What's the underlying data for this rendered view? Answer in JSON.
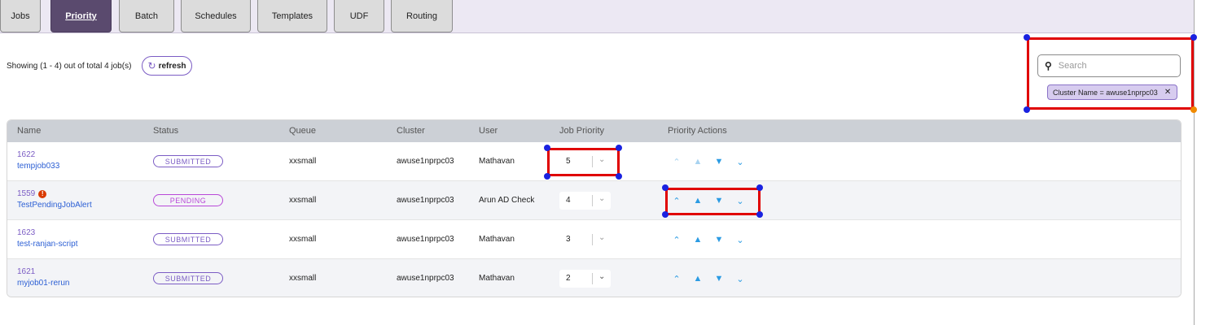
{
  "tabs": [
    {
      "label": "Jobs",
      "active": false
    },
    {
      "label": "Priority",
      "active": true
    },
    {
      "label": "Batch",
      "active": false
    },
    {
      "label": "Schedules",
      "active": false
    },
    {
      "label": "Templates",
      "active": false
    },
    {
      "label": "UDF",
      "active": false
    },
    {
      "label": "Routing",
      "active": false
    }
  ],
  "summary": {
    "showing_text": "Showing  (1 - 4)  out of total 4 job(s)",
    "refresh_label": "refresh"
  },
  "search": {
    "placeholder": "Search",
    "filter_chip": "Cluster Name = awuse1nprpc03"
  },
  "table": {
    "headers": {
      "name": "Name",
      "status": "Status",
      "queue": "Queue",
      "cluster": "Cluster",
      "user": "User",
      "job_priority": "Job Priority",
      "priority_actions": "Priority Actions"
    },
    "rows": [
      {
        "id": "1622",
        "name": "tempjob033",
        "status": "SUBMITTED",
        "queue": "xxsmall",
        "cluster": "awuse1nprpc03",
        "user": "Mathavan",
        "priority": "5",
        "warning": false
      },
      {
        "id": "1559",
        "name": "TestPendingJobAlert",
        "status": "PENDING",
        "queue": "xxsmall",
        "cluster": "awuse1nprpc03",
        "user": "Arun AD Check",
        "priority": "4",
        "warning": true
      },
      {
        "id": "1623",
        "name": "test-ranjan-script",
        "status": "SUBMITTED",
        "queue": "xxsmall",
        "cluster": "awuse1nprpc03",
        "user": "Mathavan",
        "priority": "3",
        "warning": false
      },
      {
        "id": "1621",
        "name": "myjob01-rerun",
        "status": "SUBMITTED",
        "queue": "xxsmall",
        "cluster": "awuse1nprpc03",
        "user": "Mathavan",
        "priority": "2",
        "warning": false
      }
    ]
  },
  "icons": {
    "refresh": "refresh-icon",
    "search": "search-icon",
    "close": "close-icon",
    "move_top": "double-chevron-up-icon",
    "move_up": "triangle-up-icon",
    "move_down": "triangle-down-icon",
    "move_bottom": "double-chevron-down-icon",
    "warning": "warning-icon"
  },
  "colors": {
    "accent": "#7b5cc4",
    "active_tab": "#5a4a6e",
    "link": "#2c5fd4",
    "action_icon": "#2b9be3",
    "pending": "#b848d8",
    "highlight": "#e00000"
  }
}
